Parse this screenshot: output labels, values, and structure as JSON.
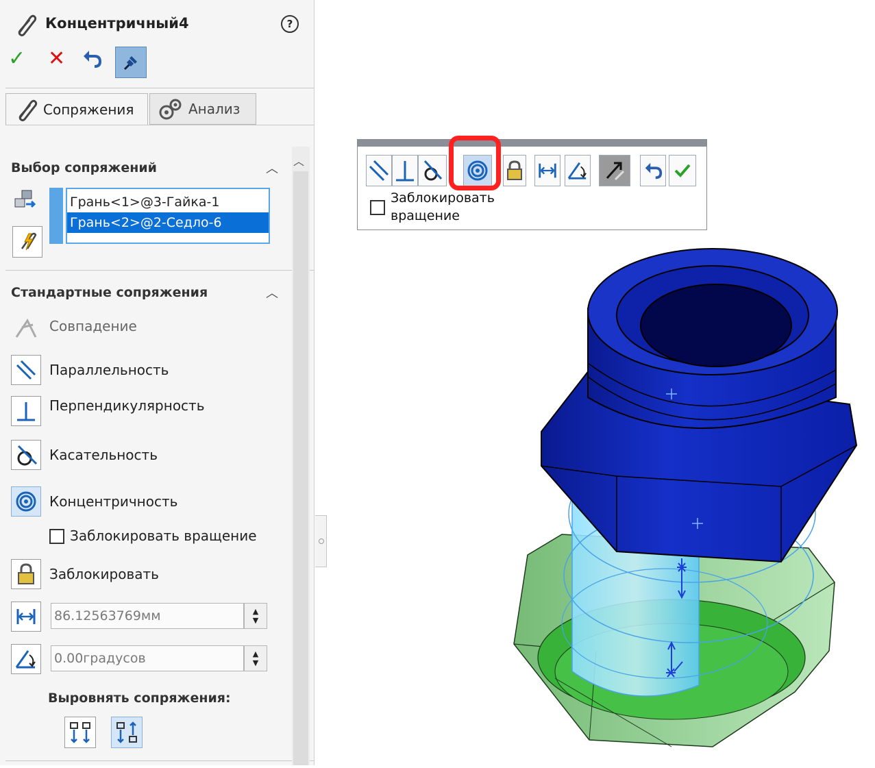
{
  "feature": {
    "title": "Концентричный4",
    "help_glyph": "?"
  },
  "actions": {
    "ok": "✓",
    "cancel": "✕"
  },
  "tabs": [
    {
      "label": "Сопряжения"
    },
    {
      "label": "Анализ"
    }
  ],
  "selection": {
    "header": "Выбор сопряжений",
    "items": [
      {
        "label": "Грань<1>@3-Гайка-1",
        "selected": false
      },
      {
        "label": "Грань<2>@2-Седло-6",
        "selected": true
      }
    ]
  },
  "standard": {
    "header": "Стандартные сопряжения",
    "coincident": "Совпадение",
    "parallel": "Параллельность",
    "perpendicular": "Перпендикулярность",
    "tangent": "Касательность",
    "concentric": "Концентричность",
    "lock_rotation": "Заблокировать вращение",
    "lock": "Заблокировать",
    "distance_value": "86.12563769мм",
    "angle_value": "0.00градусов",
    "align_label": "Выровнять сопряжения:"
  },
  "popup": {
    "lock_rotation_line1": "Заблокировать",
    "lock_rotation_line2": "вращение"
  },
  "colors": {
    "accent": "#0a6fd6",
    "selection_border": "#5aa5e6",
    "highlight": "#ff2020",
    "nut": "#0b1fb0",
    "seat": "#3aa33a",
    "preview": "#7fd0ff"
  }
}
